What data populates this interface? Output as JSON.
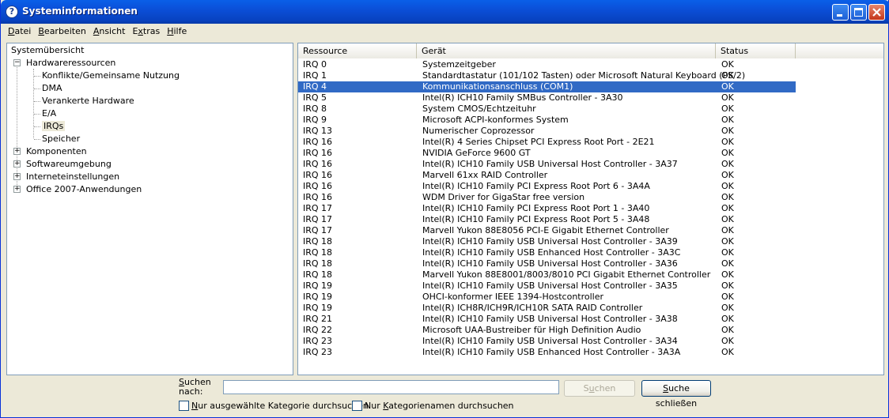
{
  "window": {
    "title": "Systeminformationen",
    "controls": [
      "minimize",
      "maximize",
      "close"
    ]
  },
  "menu": [
    {
      "prefix": "",
      "accel": "D",
      "rest": "atei"
    },
    {
      "prefix": "",
      "accel": "B",
      "rest": "earbeiten"
    },
    {
      "prefix": "",
      "accel": "A",
      "rest": "nsicht"
    },
    {
      "prefix": "E",
      "accel": "x",
      "rest": "tras"
    },
    {
      "prefix": "",
      "accel": "H",
      "rest": "ilfe"
    }
  ],
  "tree": {
    "root": "Systemübersicht",
    "hardware": "Hardwareressourcen",
    "hardware_children": [
      "Konflikte/Gemeinsame Nutzung",
      "DMA",
      "Verankerte Hardware",
      "E/A",
      "IRQs",
      "Speicher"
    ],
    "selected": "IRQs",
    "collapsed": [
      "Komponenten",
      "Softwareumgebung",
      "Interneteinstellungen",
      "Office 2007-Anwendungen"
    ]
  },
  "table": {
    "columns": [
      "Ressource",
      "Gerät",
      "Status"
    ],
    "selected_index": 2,
    "rows": [
      [
        "IRQ 0",
        "Systemzeitgeber",
        "OK"
      ],
      [
        "IRQ 1",
        "Standardtastatur (101/102 Tasten) oder Microsoft Natural Keyboard (PS/2)",
        "OK"
      ],
      [
        "IRQ 4",
        "Kommunikationsanschluss (COM1)",
        "OK"
      ],
      [
        "IRQ 5",
        "Intel(R) ICH10 Family SMBus Controller - 3A30",
        "OK"
      ],
      [
        "IRQ 8",
        "System CMOS/Echtzeituhr",
        "OK"
      ],
      [
        "IRQ 9",
        "Microsoft ACPI-konformes System",
        "OK"
      ],
      [
        "IRQ 13",
        "Numerischer Coprozessor",
        "OK"
      ],
      [
        "IRQ 16",
        "Intel(R) 4 Series Chipset PCI Express Root Port - 2E21",
        "OK"
      ],
      [
        "IRQ 16",
        "NVIDIA GeForce 9600 GT",
        "OK"
      ],
      [
        "IRQ 16",
        "Intel(R) ICH10 Family USB Universal Host Controller - 3A37",
        "OK"
      ],
      [
        "IRQ 16",
        "Marvell 61xx RAID Controller",
        "OK"
      ],
      [
        "IRQ 16",
        "Intel(R) ICH10 Family PCI Express Root Port 6 - 3A4A",
        "OK"
      ],
      [
        "IRQ 16",
        "WDM Driver for GigaStar free version",
        "OK"
      ],
      [
        "IRQ 17",
        "Intel(R) ICH10 Family PCI Express Root Port 1 - 3A40",
        "OK"
      ],
      [
        "IRQ 17",
        "Intel(R) ICH10 Family PCI Express Root Port 5 - 3A48",
        "OK"
      ],
      [
        "IRQ 17",
        "Marvell Yukon 88E8056 PCI-E Gigabit Ethernet Controller",
        "OK"
      ],
      [
        "IRQ 18",
        "Intel(R) ICH10 Family USB Universal Host Controller - 3A39",
        "OK"
      ],
      [
        "IRQ 18",
        "Intel(R) ICH10 Family USB Enhanced Host Controller - 3A3C",
        "OK"
      ],
      [
        "IRQ 18",
        "Intel(R) ICH10 Family USB Universal Host Controller - 3A36",
        "OK"
      ],
      [
        "IRQ 18",
        "Marvell Yukon 88E8001/8003/8010 PCI Gigabit Ethernet Controller",
        "OK"
      ],
      [
        "IRQ 19",
        "Intel(R) ICH10 Family USB Universal Host Controller - 3A35",
        "OK"
      ],
      [
        "IRQ 19",
        "OHCI-konformer IEEE 1394-Hostcontroller",
        "OK"
      ],
      [
        "IRQ 19",
        "Intel(R) ICH8R/ICH9R/ICH10R SATA RAID Controller",
        "OK"
      ],
      [
        "IRQ 21",
        "Intel(R) ICH10 Family USB Universal Host Controller - 3A38",
        "OK"
      ],
      [
        "IRQ 22",
        "Microsoft UAA-Bustreiber für High Definition Audio",
        "OK"
      ],
      [
        "IRQ 23",
        "Intel(R) ICH10 Family USB Universal Host Controller - 3A34",
        "OK"
      ],
      [
        "IRQ 23",
        "Intel(R) ICH10 Family USB Enhanced Host Controller - 3A3A",
        "OK"
      ]
    ]
  },
  "search": {
    "label_accel": "S",
    "label_line1_rest": "uchen",
    "label_line2": "nach:",
    "value": "",
    "search_btn_pre": "S",
    "search_btn_accel": "u",
    "search_btn_rest": "chen",
    "close_btn_accel": "S",
    "close_btn_rest": "uche schließen",
    "check1_accel": "N",
    "check1_rest": "ur ausgewählte Kategorie durchsuchen",
    "check1_checked": false,
    "check2_pre": "Nur ",
    "check2_accel": "K",
    "check2_rest": "ategorienamen durchsuchen",
    "check2_checked": false
  }
}
